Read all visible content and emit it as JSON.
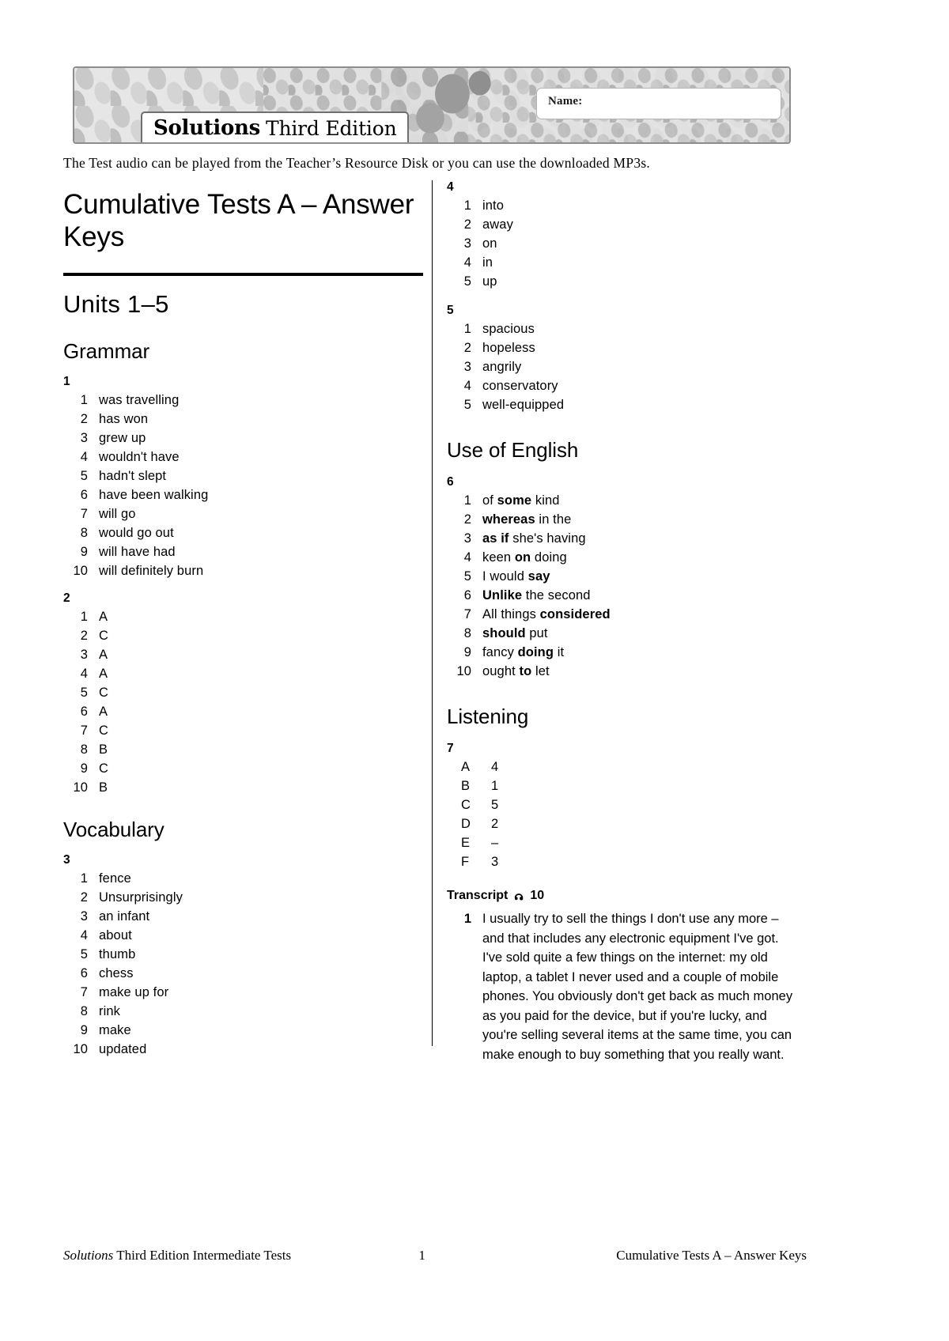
{
  "header": {
    "name_label": "Name:",
    "logo_primary": "Solutions",
    "logo_secondary": "Third Edition"
  },
  "intro": "The Test audio can be played from the Teacher’s Resource Disk or you can use the downloaded MP3s.",
  "doc_title": "Cumulative Tests A – Answer Keys",
  "units_title": "Units 1–5",
  "sections": {
    "grammar": "Grammar",
    "vocabulary": "Vocabulary",
    "use_of_english": "Use of English",
    "listening": "Listening"
  },
  "exercises": {
    "ex1": {
      "number": "1",
      "items": [
        {
          "label": "1",
          "text": "was travelling"
        },
        {
          "label": "2",
          "text": "has won"
        },
        {
          "label": "3",
          "text": "grew up"
        },
        {
          "label": "4",
          "text": "wouldn't have"
        },
        {
          "label": "5",
          "text": "hadn't slept"
        },
        {
          "label": "6",
          "text": "have been walking"
        },
        {
          "label": "7",
          "text": "will go"
        },
        {
          "label": "8",
          "text": "would go out"
        },
        {
          "label": "9",
          "text": "will have had"
        },
        {
          "label": "10",
          "text": "will definitely burn"
        }
      ]
    },
    "ex2": {
      "number": "2",
      "items": [
        {
          "label": "1",
          "text": "A"
        },
        {
          "label": "2",
          "text": "C"
        },
        {
          "label": "3",
          "text": "A"
        },
        {
          "label": "4",
          "text": "A"
        },
        {
          "label": "5",
          "text": "C"
        },
        {
          "label": "6",
          "text": "A"
        },
        {
          "label": "7",
          "text": "C"
        },
        {
          "label": "8",
          "text": "B"
        },
        {
          "label": "9",
          "text": "C"
        },
        {
          "label": "10",
          "text": "B"
        }
      ]
    },
    "ex3": {
      "number": "3",
      "items": [
        {
          "label": "1",
          "text": "fence"
        },
        {
          "label": "2",
          "text": "Unsurprisingly"
        },
        {
          "label": "3",
          "text": "an infant"
        },
        {
          "label": "4",
          "text": "about"
        },
        {
          "label": "5",
          "text": "thumb"
        },
        {
          "label": "6",
          "text": "chess"
        },
        {
          "label": "7",
          "text": "make up for"
        },
        {
          "label": "8",
          "text": "rink"
        },
        {
          "label": "9",
          "text": "make"
        },
        {
          "label": "10",
          "text": "updated"
        }
      ]
    },
    "ex4": {
      "number": "4",
      "items": [
        {
          "label": "1",
          "text": "into"
        },
        {
          "label": "2",
          "text": "away"
        },
        {
          "label": "3",
          "text": "on"
        },
        {
          "label": "4",
          "text": "in"
        },
        {
          "label": "5",
          "text": "up"
        }
      ]
    },
    "ex5": {
      "number": "5",
      "items": [
        {
          "label": "1",
          "text": "spacious"
        },
        {
          "label": "2",
          "text": "hopeless"
        },
        {
          "label": "3",
          "text": "angrily"
        },
        {
          "label": "4",
          "text": "conservatory"
        },
        {
          "label": "5",
          "text": "well-equipped"
        }
      ]
    },
    "ex6": {
      "number": "6",
      "items": [
        {
          "label": "1",
          "html": "of <b>some</b> kind"
        },
        {
          "label": "2",
          "html": "<b>whereas</b> in the"
        },
        {
          "label": "3",
          "html": "<b>as if</b> she's having"
        },
        {
          "label": "4",
          "html": "keen <b>on</b> doing"
        },
        {
          "label": "5",
          "html": "I would <b>say</b>"
        },
        {
          "label": "6",
          "html": "<b>Unlike</b> the second"
        },
        {
          "label": "7",
          "html": "All things <b>considered</b>"
        },
        {
          "label": "8",
          "html": "<b>should</b> put"
        },
        {
          "label": "9",
          "html": "fancy <b>doing</b> it"
        },
        {
          "label": "10",
          "html": "ought <b>to</b> let"
        }
      ]
    },
    "ex7": {
      "number": "7",
      "items": [
        {
          "label": "A",
          "text": "4"
        },
        {
          "label": "B",
          "text": "1"
        },
        {
          "label": "C",
          "text": "5"
        },
        {
          "label": "D",
          "text": "2"
        },
        {
          "label": "E",
          "text": "–"
        },
        {
          "label": "F",
          "text": "3"
        }
      ]
    }
  },
  "transcript": {
    "label": "Transcript",
    "icon": "audio-icon",
    "track": "10",
    "number": "1",
    "text": "I usually try to sell the things I don't use any more – and that includes any electronic equipment I've got. I've sold quite a few things on the internet: my old laptop, a tablet I never used and a couple of mobile phones. You obviously don't get back as much money as you paid for the device, but if you're lucky, and you're selling several items at the same time, you can make enough to buy something that you really want."
  },
  "footer": {
    "left_italic": "Solutions",
    "left_rest": "Third Edition Intermediate Tests",
    "page_number": "1",
    "right": "Cumulative Tests A – Answer Keys"
  }
}
